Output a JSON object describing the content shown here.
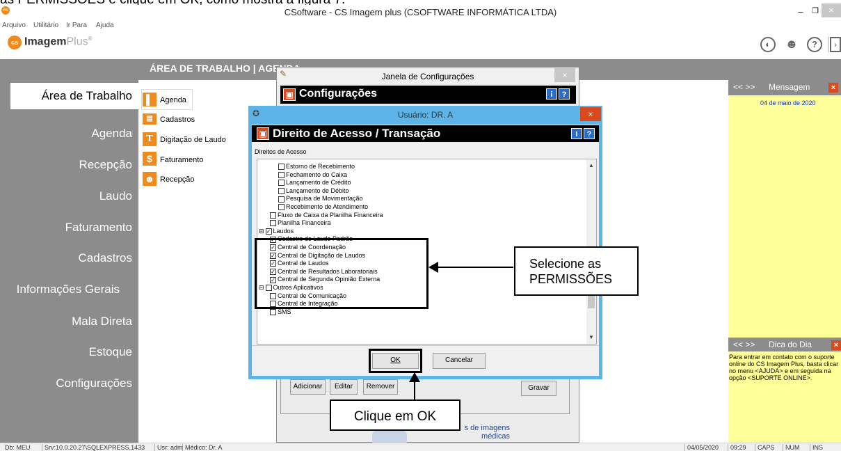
{
  "document": {
    "caption": "as PERMISSÕES e clique em OK, como mostra a figura 7:"
  },
  "window": {
    "title": "CSoftware - CS Imagem plus (CSOFTWARE INFORMÁTICA LTDA)",
    "app_icon": "cs"
  },
  "menu": [
    "Arquivo",
    "Utilitário",
    "Ir Para",
    "Ajuda"
  ],
  "brand": {
    "name": "Imagem",
    "suffix": "Plus",
    "mark": "®",
    "badge": "cs"
  },
  "sidebar": {
    "items": [
      {
        "label": "Área de Trabalho",
        "active": true
      },
      {
        "label": "Agenda"
      },
      {
        "label": "Recepção"
      },
      {
        "label": "Laudo"
      },
      {
        "label": "Faturamento"
      },
      {
        "label": "Cadastros"
      },
      {
        "label": "Informações Gerais"
      },
      {
        "label": "Mala Direta"
      },
      {
        "label": "Estoque"
      },
      {
        "label": "Configurações"
      }
    ]
  },
  "workspace": {
    "title": "ÁREA DE TRABALHO | AGENDA",
    "apps": [
      {
        "label": "Agenda",
        "icon": "agenda-icon"
      },
      {
        "label": "Cadastros",
        "icon": "cadastros-icon"
      },
      {
        "label": "Digitação de Laudo",
        "icon": "text-icon"
      },
      {
        "label": "Faturamento",
        "icon": "dollar-icon"
      },
      {
        "label": "Recepção",
        "icon": "reception-icon"
      }
    ]
  },
  "right_panel": {
    "message": {
      "nav": "<< >>",
      "title": "Mensagem",
      "date": "04 de maio de 2020"
    },
    "tip": {
      "nav": "<< >>",
      "title": "Dica do Dia",
      "text": "Para entrar em contato com o suporte online do CS Imagem Plus, basta clicar no menu <AJUDA> e em seguida na opção <SUPORTE ONLINE>."
    }
  },
  "config_window": {
    "title": "Janela de Configurações",
    "heading": "Configurações",
    "buttons": {
      "add": "Adicionar",
      "edit": "Editar",
      "remove": "Remover",
      "save": "Gravar"
    },
    "logo_text": "s de imagens médicas"
  },
  "user_window": {
    "title": "Usuário: DR. A",
    "heading": "Direito de Acesso / Transação",
    "section_label": "Direitos de Acesso",
    "tree": [
      {
        "label": "Estorno de Recebimento",
        "checked": false,
        "level": 2
      },
      {
        "label": "Fechamento do Caixa",
        "checked": false,
        "level": 2
      },
      {
        "label": "Lançamento de Crédito",
        "checked": false,
        "level": 2
      },
      {
        "label": "Lançamento de Débito",
        "checked": false,
        "level": 2
      },
      {
        "label": "Pesquisa de Movimentação",
        "checked": false,
        "level": 2
      },
      {
        "label": "Recebimento de Atendimento",
        "checked": false,
        "level": 2
      },
      {
        "label": "Fluxo de Caixa da Planilha Financeira",
        "checked": false,
        "level": 1
      },
      {
        "label": "Planilha Financeira",
        "checked": false,
        "level": 1
      },
      {
        "label": "Laudos",
        "checked": true,
        "level": 0
      },
      {
        "label": "Cadastro de Laudo Padrão",
        "checked": true,
        "level": 1
      },
      {
        "label": "Central de Coordenação",
        "checked": true,
        "level": 1
      },
      {
        "label": "Central de Digitação de Laudos",
        "checked": true,
        "level": 1
      },
      {
        "label": "Central de Laudos",
        "checked": true,
        "level": 1
      },
      {
        "label": "Central de Resultados Laboratoriais",
        "checked": true,
        "level": 1
      },
      {
        "label": "Central de Segunda Opinião Externa",
        "checked": true,
        "level": 1
      },
      {
        "label": "Outros Aplicativos",
        "checked": false,
        "level": 0
      },
      {
        "label": "Central de Comunicação",
        "checked": false,
        "level": 1
      },
      {
        "label": "Central de Integração",
        "checked": false,
        "level": 1
      },
      {
        "label": "SMS",
        "checked": false,
        "level": 1
      }
    ],
    "buttons": {
      "ok": "OK",
      "cancel": "Cancelar"
    }
  },
  "annotations": {
    "permissions": [
      "Selecione as",
      "PERMISSÕES"
    ],
    "ok": "Clique em OK"
  },
  "statusbar": [
    "Db: MEU",
    "Srv:10.0.20.27\\SQLEXPRESS,1433",
    "Usr: adm",
    "Médico: Dr. A",
    "04/05/2020",
    "09:29",
    "CAPS",
    "NUM",
    "INS"
  ],
  "colors": {
    "sidebar": "#8c8c8c",
    "accent": "#f08a1c",
    "panel": "#ffff99",
    "dialog_border": "#5cb4e8",
    "close_red": "#d94a1e"
  }
}
